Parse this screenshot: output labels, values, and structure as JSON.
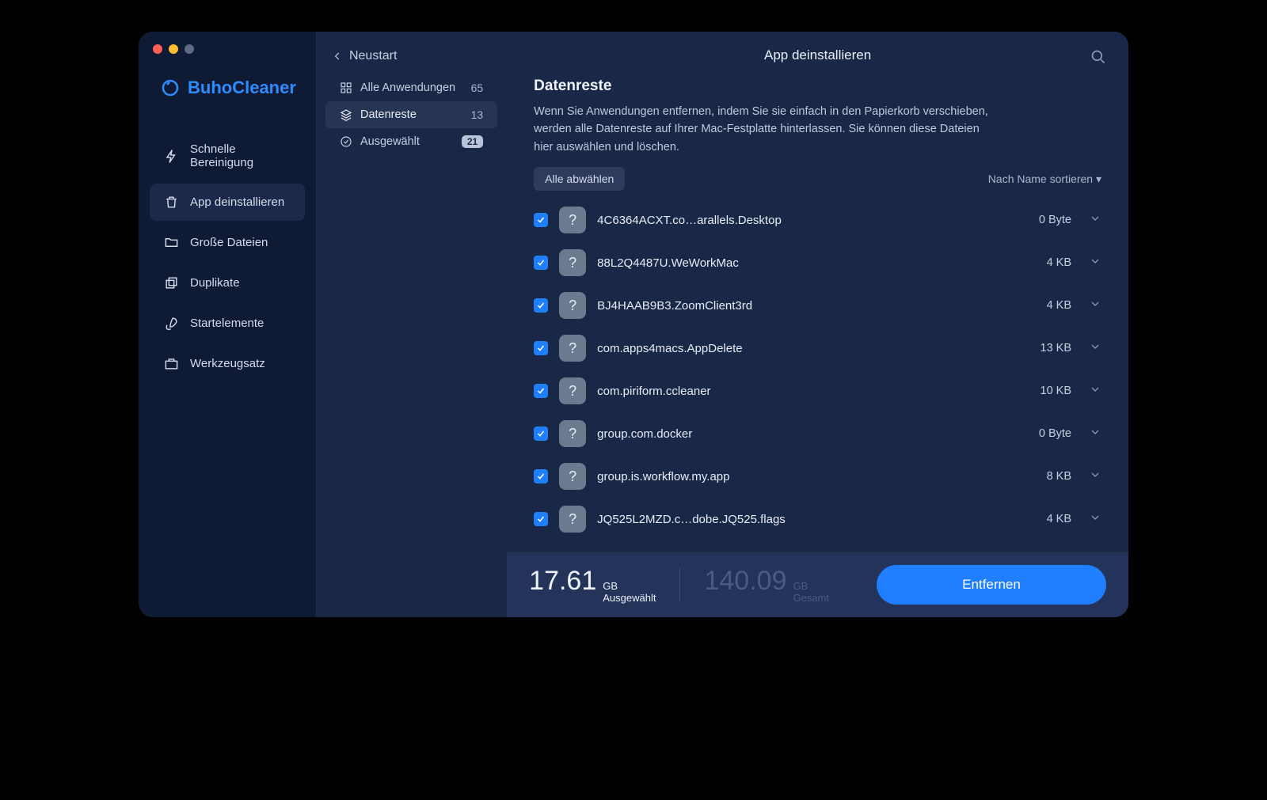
{
  "app_name": "BuhoCleaner",
  "nav": {
    "quick_clean": "Schnelle Bereinigung",
    "uninstall": "App deinstallieren",
    "large_files": "Große Dateien",
    "duplicates": "Duplikate",
    "startup": "Startelemente",
    "toolbox": "Werkzeugsatz"
  },
  "back_label": "Neustart",
  "filters": {
    "all": {
      "label": "Alle Anwendungen",
      "count": "65"
    },
    "leftovers": {
      "label": "Datenreste",
      "count": "13"
    },
    "selected": {
      "label": "Ausgewählt",
      "count": "21"
    }
  },
  "header_title": "App deinstallieren",
  "section_title": "Datenreste",
  "section_desc": "Wenn Sie Anwendungen entfernen, indem Sie sie einfach in den Papierkorb verschieben, werden alle Datenreste auf Ihrer Mac-Festplatte hinterlassen. Sie können diese Dateien hier auswählen und löschen.",
  "deselect_all": "Alle abwählen",
  "sort_label": "Nach Name sortieren ▾",
  "items": [
    {
      "name": "4C6364ACXT.co…arallels.Desktop",
      "size": "0 Byte"
    },
    {
      "name": "88L2Q4487U.WeWorkMac",
      "size": "4 KB"
    },
    {
      "name": "BJ4HAAB9B3.ZoomClient3rd",
      "size": "4 KB"
    },
    {
      "name": "com.apps4macs.AppDelete",
      "size": "13 KB"
    },
    {
      "name": "com.piriform.ccleaner",
      "size": "10 KB"
    },
    {
      "name": "group.com.docker",
      "size": "0 Byte"
    },
    {
      "name": "group.is.workflow.my.app",
      "size": "8 KB"
    },
    {
      "name": "JQ525L2MZD.c…dobe.JQ525.flags",
      "size": "4 KB"
    }
  ],
  "footer": {
    "selected_value": "17.61",
    "selected_unit": "GB",
    "selected_label": "Ausgewählt",
    "total_value": "140.09",
    "total_unit": "GB",
    "total_label": "Gesamt",
    "remove_button": "Entfernen"
  }
}
